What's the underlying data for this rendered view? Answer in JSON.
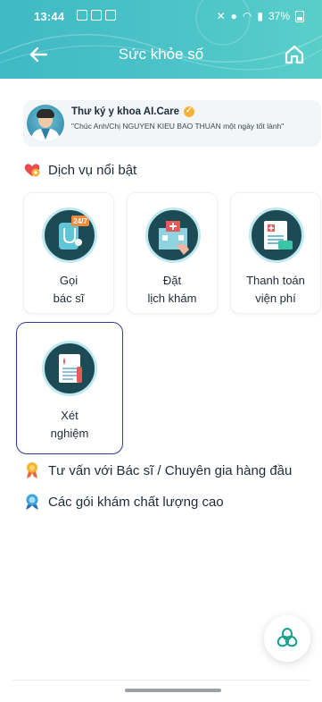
{
  "status_bar": {
    "time": "13:44",
    "battery": "37%"
  },
  "header": {
    "title": "Sức khỏe số"
  },
  "assistant": {
    "name": "Thư ký y khoa AI.Care",
    "greeting": "\"Chúc Anh/Chị NGUYEN KIEU BAO THUAN một ngày tốt lành\""
  },
  "featured": {
    "heading": "Dịch vụ nổi bật",
    "services": [
      {
        "line1": "Gọi",
        "line2": "bác sĩ"
      },
      {
        "line1": "Đặt",
        "line2": "lịch khám"
      },
      {
        "line1": "Thanh toán",
        "line2": "viện phí"
      },
      {
        "line1": "Xét",
        "line2": "nghiệm"
      }
    ]
  },
  "consult": {
    "heading": "Tư vấn với Bác sĩ / Chuyên gia hàng đầu"
  },
  "packages": {
    "heading": "Các gói khám chất lượng cao"
  },
  "badge_247": "24/7",
  "colors": {
    "header": "#4cc3c8",
    "selected_border": "#2e3f8f",
    "icon_bg": "#1d4b55"
  }
}
